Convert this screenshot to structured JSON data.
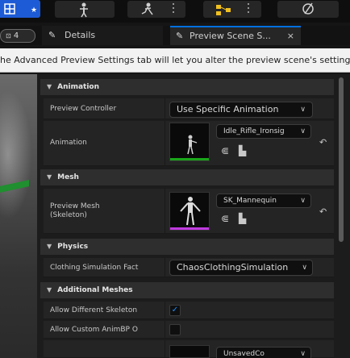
{
  "tabs": {
    "badge": "4",
    "details": "Details",
    "preview": "Preview Scene S...",
    "close": "×"
  },
  "help_text": "he Advanced Preview Settings tab will let you alter the preview scene's settings.",
  "sections": {
    "animation": {
      "title": "Animation",
      "preview_controller_label": "Preview Controller",
      "preview_controller_value": "Use Specific Animation",
      "animation_label": "Animation",
      "animation_value": "Idle_Rifle_Ironsig"
    },
    "mesh": {
      "title": "Mesh",
      "preview_mesh_label_1": "Preview Mesh",
      "preview_mesh_label_2": "(Skeleton)",
      "preview_mesh_value": "SK_Mannequin"
    },
    "physics": {
      "title": "Physics",
      "clothing_label": "Clothing Simulation Fact",
      "clothing_value": "ChaosClothingSimulation"
    },
    "additional_meshes": {
      "title": "Additional Meshes",
      "allow_skeleton_label": "Allow Different Skeleton",
      "allow_skeleton_checked": true,
      "allow_anim_bp_label": "Allow Custom AnimBP O",
      "allow_anim_bp_checked": false,
      "unsaved_value": "UnsavedCo"
    }
  },
  "glyphs": {
    "chevron": "∨",
    "expanded": "▼",
    "browse": "⋐",
    "folder": "▙",
    "reset": "↶",
    "check": "✓"
  },
  "colors": {
    "accent_blue": "#0070e0",
    "toolbar_blue": "#1d5bd6",
    "anim_bar": "#1aa61a",
    "mesh_bar": "#c03ae0"
  }
}
